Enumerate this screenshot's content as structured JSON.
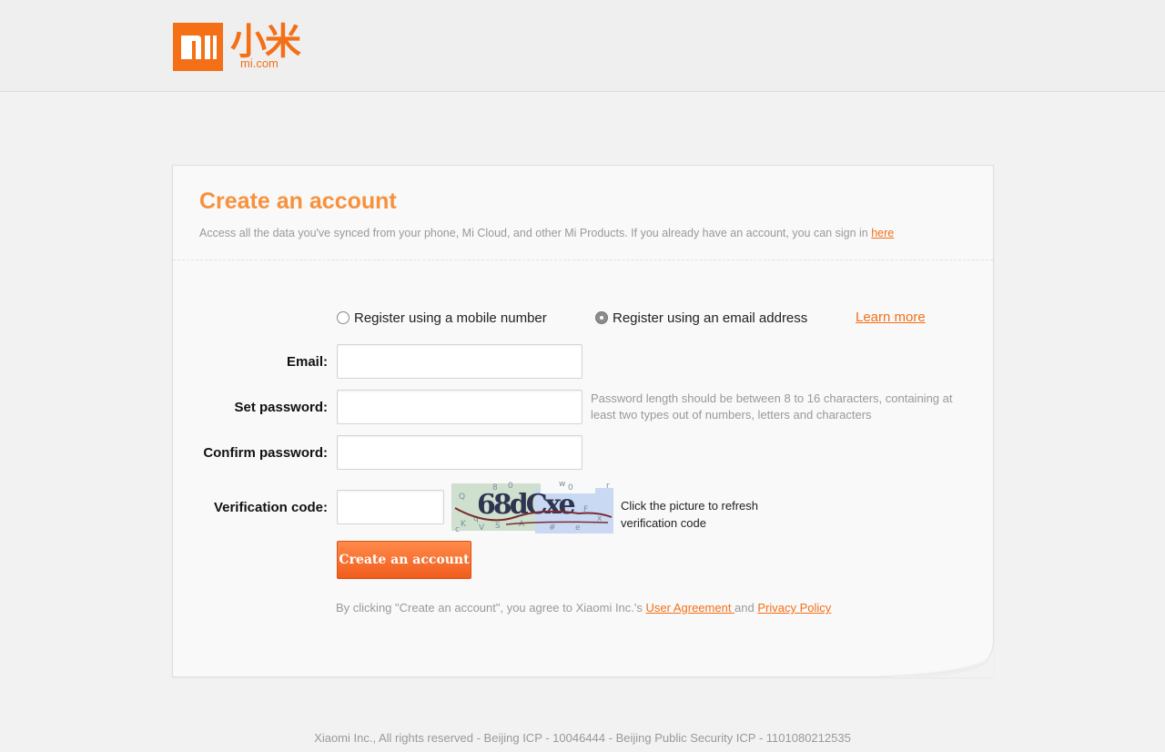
{
  "header": {
    "logo_mark": "MI",
    "logo_chinese": "小米",
    "logo_domain": "mi.com"
  },
  "card": {
    "title": "Create an account",
    "subtitle": "Access all the data you've synced from your phone, Mi Cloud, and other Mi Products. If you already have an account, you can sign in ",
    "sign_in_link": "here"
  },
  "register_options": [
    {
      "label": "Register using a mobile number",
      "checked": false
    },
    {
      "label": "Register using an email address",
      "checked": true
    }
  ],
  "learn_more": "Learn more",
  "form": {
    "email_label": "Email:",
    "email_value": "",
    "password_label": "Set password:",
    "password_value": "",
    "password_hint": "Password length should be between 8 to 16 characters, containing at least two types out of numbers, letters and characters",
    "confirm_label": "Confirm password:",
    "confirm_value": "",
    "verification_label": "Verification code:",
    "verification_value": "",
    "captcha_text": "68dCxe",
    "captcha_hint": "Click the picture to refresh verification code"
  },
  "submit_label": "Create an account",
  "agreement": {
    "prefix": "By clicking \"Create an account\", you agree to Xiaomi Inc.'s ",
    "user_agreement": "User Agreement ",
    "and": "and ",
    "privacy_policy": "Privacy Policy"
  },
  "footer": "Xiaomi Inc., All rights reserved - Beijing ICP - 10046444 - Beijing Public Security ICP - 1101080212535",
  "colors": {
    "brand": "#f46f16",
    "title": "#f7913c",
    "button": "#f05d1d"
  }
}
